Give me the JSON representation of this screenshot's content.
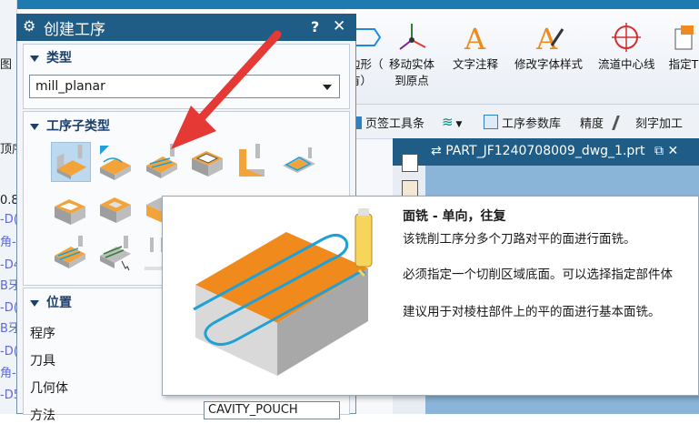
{
  "ribbon": {
    "items": [
      {
        "label": "边形（\n有）",
        "icon": "shape-icon"
      },
      {
        "label": "移动实体\n到原点",
        "icon": "move-origin-icon"
      },
      {
        "label": "文字注释",
        "icon": "text-note-icon"
      },
      {
        "label": "修改字体样式",
        "icon": "font-style-icon"
      },
      {
        "label": "流道中心线",
        "icon": "runner-centerline-icon"
      },
      {
        "label": "指定T",
        "icon": "specify-icon"
      }
    ]
  },
  "toolbar2": {
    "page_toolbar": "页签工具条",
    "process_param_lib": "工序参数库",
    "precision": "精度",
    "engrave": "刻字加工"
  },
  "tab": {
    "label": "PART_JF1240708009_dwg_1.prt"
  },
  "left_strip": {
    "items": [
      "图",
      "顶序",
      "0.8",
      "-D(",
      "角-",
      "-D4",
      "B牙",
      "-D(",
      "B牙",
      "-D(",
      "角-",
      "-D5"
    ]
  },
  "dialog": {
    "title": "创建工序",
    "help": "?",
    "close": "✕",
    "type_section": "类型",
    "type_value": "mill_planar",
    "subtype_section": "工序子类型",
    "position_section": "位置",
    "position_labels": [
      "程序",
      "刀具",
      "几何体",
      "方法"
    ],
    "method_value": "CAVITY_POUCH"
  },
  "tooltip": {
    "title": "面铣 - 单向，往复",
    "line1": "该铣削工序分多个刀路对平的面进行面铣。",
    "line2": "必须指定一个切削区域底面。可以选择指定部件体",
    "line3": "建议用于对棱柱部件上的平的面进行基本面铣。"
  },
  "colors": {
    "title_bar": "#1f5d86",
    "tooltip_part_top": "#f08a1c",
    "toolpath": "#1fa0d6",
    "arrow": "#e53935"
  }
}
